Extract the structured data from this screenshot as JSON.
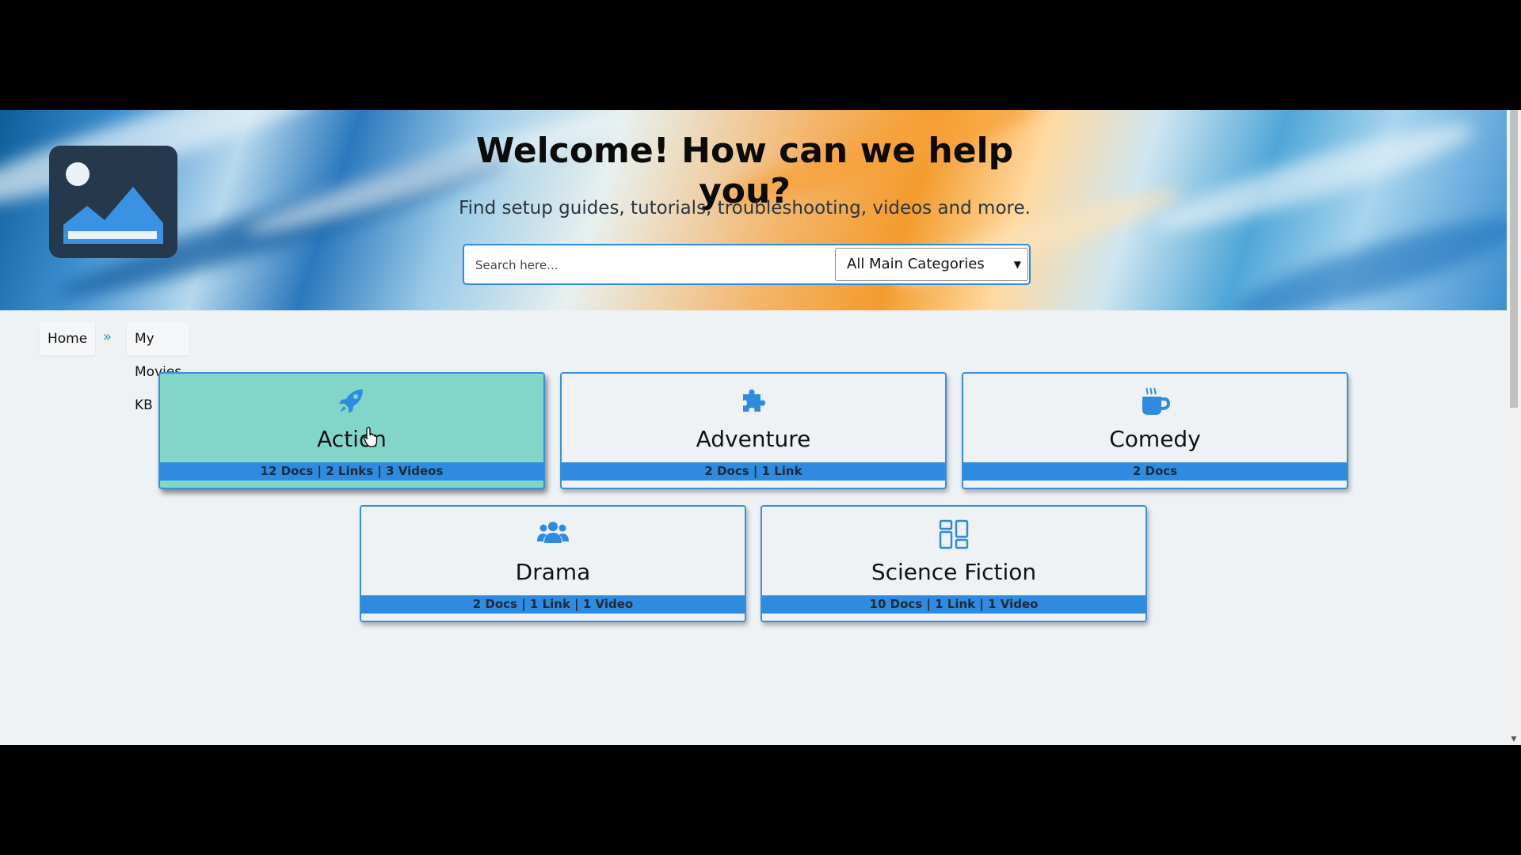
{
  "hero": {
    "title": "Welcome! How can we help you?",
    "subtitle": "Find setup guides, tutorials, troubleshooting, videos and more.",
    "logo_icon": "image-placeholder-icon"
  },
  "search": {
    "placeholder": "Search here...",
    "value": "",
    "category_selected": "All Main Categories"
  },
  "breadcrumb": {
    "items": [
      "Home",
      "My Movies KB"
    ],
    "separator": "»"
  },
  "categories": [
    {
      "label": "Action",
      "stats": "12 Docs | 2 Links | 3 Videos",
      "icon": "rocket-icon",
      "active": true
    },
    {
      "label": "Adventure",
      "stats": "2 Docs | 1 Link",
      "icon": "puzzle-icon",
      "active": false
    },
    {
      "label": "Comedy",
      "stats": "2 Docs",
      "icon": "coffee-cup-icon",
      "active": false
    },
    {
      "label": "Drama",
      "stats": "2 Docs | 1 Link | 1 Video",
      "icon": "users-icon",
      "active": false
    },
    {
      "label": "Science Fiction",
      "stats": "10 Docs | 1 Link | 1 Video",
      "icon": "dashboard-grid-icon",
      "active": false
    }
  ],
  "colors": {
    "accent": "#2f8be0",
    "active_card": "#82d6c8",
    "logo_bg": "#25384c",
    "page_bg": "#eef2f5"
  }
}
